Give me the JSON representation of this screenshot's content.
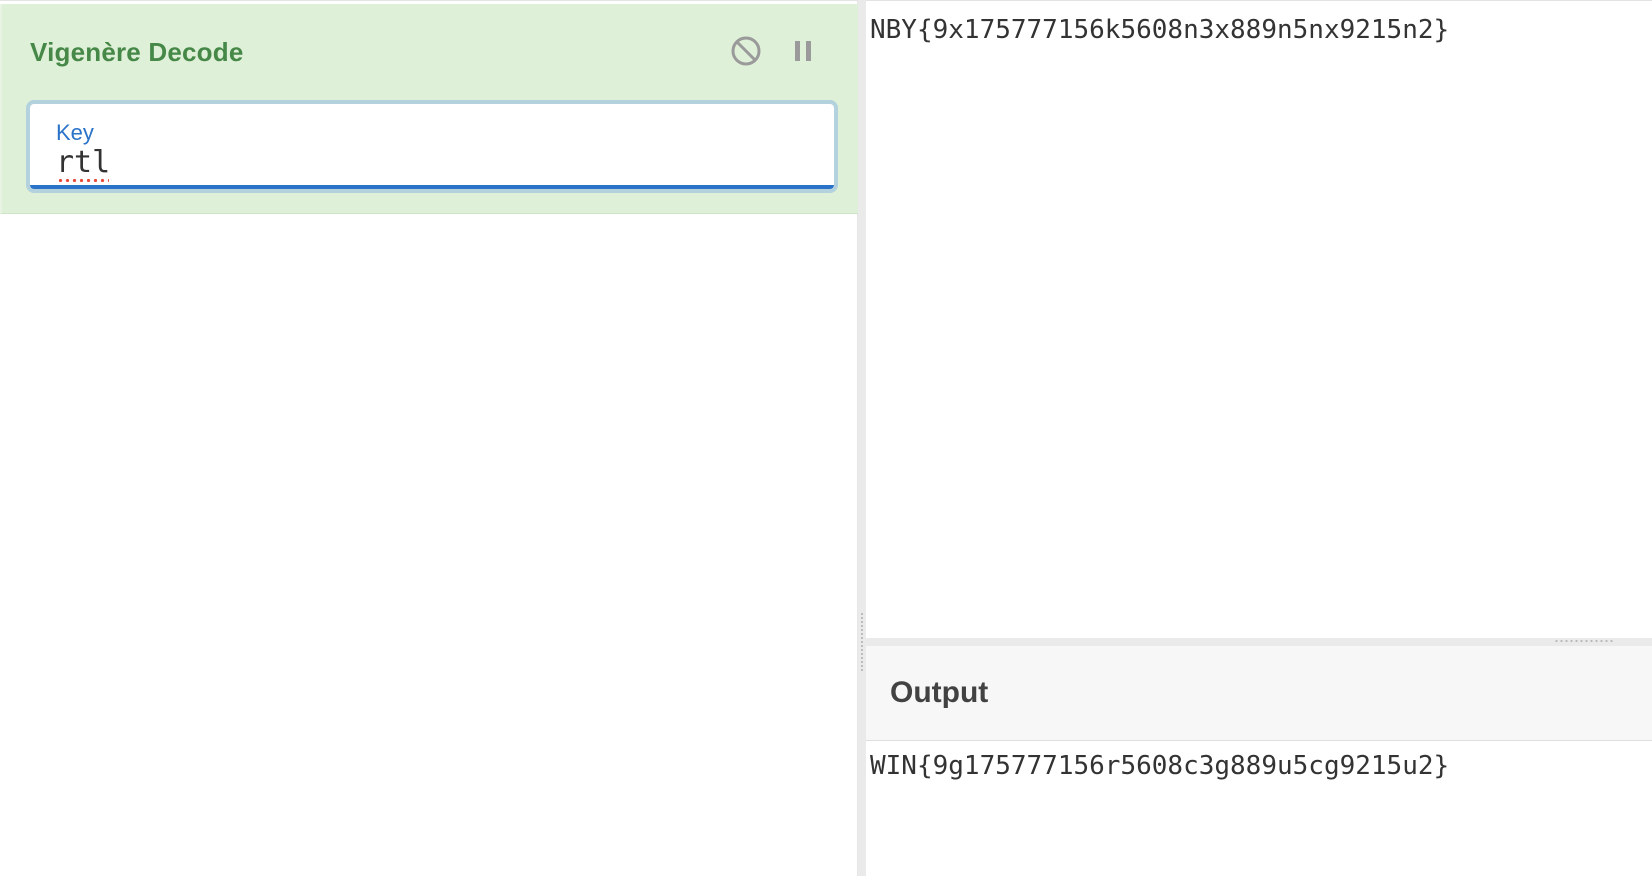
{
  "recipe": {
    "operation": {
      "title": "Vigenère Decode",
      "disable_icon": "disable-icon",
      "pause_icon": "pause-icon",
      "key": {
        "label": "Key",
        "value": "rtl"
      }
    }
  },
  "input": {
    "text": "NBY{9x175777156k5608n3x889n5nx9215n2}"
  },
  "output": {
    "title": "Output",
    "text": "WIN{9g175777156r5608c3g889u5cg9215u2}"
  },
  "colors": {
    "operation_bg": "#dff0d8",
    "operation_title": "#468847",
    "key_accent": "#2a73c8",
    "text": "#333333"
  }
}
